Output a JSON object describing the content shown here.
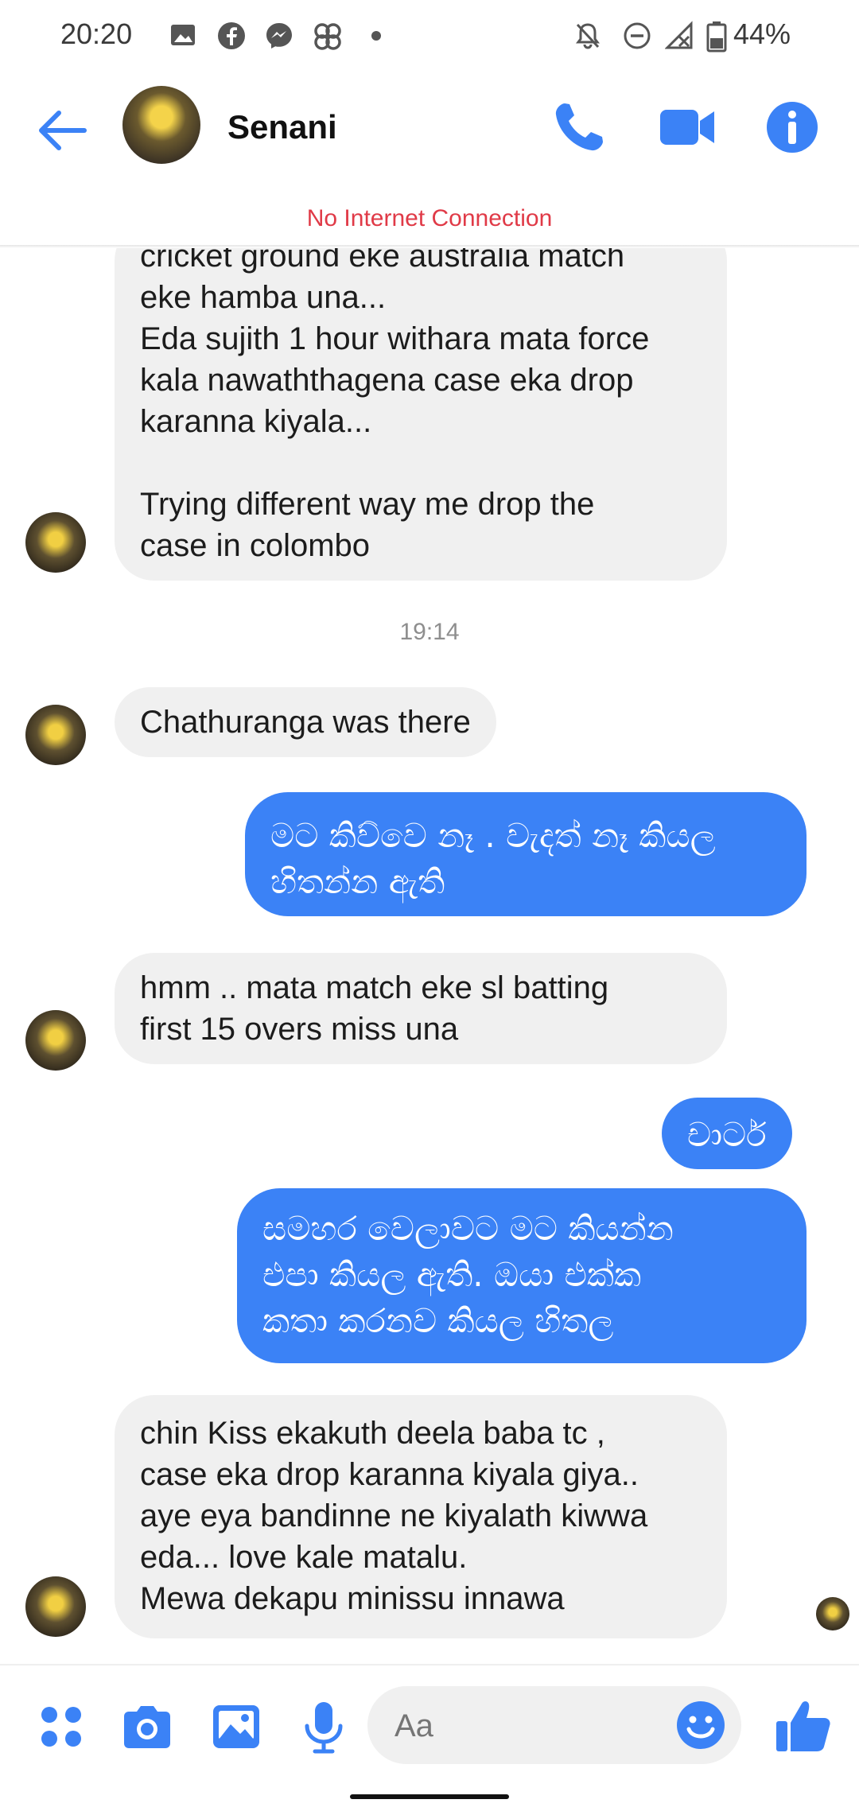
{
  "status_bar": {
    "time": "20:20",
    "battery": "44%"
  },
  "header": {
    "contact_name": "Senani",
    "banner": "No Internet Connection",
    "icons": [
      "back-arrow-icon",
      "phone-icon",
      "video-camera-icon",
      "info-icon"
    ]
  },
  "messages": [
    {
      "dir": "in",
      "text": "cricket ground eke australia match\neke hamba una...\nEda sujith 1 hour withara mata force\nkala nawaththagena case eka drop\nkaranna kiyala...\n\nTrying different  way me drop the\ncase in colombo"
    },
    {
      "dir": "time",
      "text": "19:14"
    },
    {
      "dir": "in",
      "text": "Chathuranga was there"
    },
    {
      "dir": "out",
      "text": "මට කිව්වෙ නෑ . වැදත් නෑ කියල\nහිතන්න ඇති"
    },
    {
      "dir": "in",
      "text": "hmm .. mata match eke sl batting\nfirst 15 overs miss una"
    },
    {
      "dir": "out",
      "text": "චාටර්"
    },
    {
      "dir": "out",
      "text": "සමහර වෙලාවට මට කියන්න\nඑපා කියල ඇති. ඔයා එක්ක\nකතා කරනව කියල හිතල"
    },
    {
      "dir": "in",
      "text": "chin Kiss ekakuth deela baba  tc ,\ncase eka drop karanna kiyala giya..\naye eya bandinne ne kiyalath kiwwa\neda...  love kale matalu.\nMewa dekapu minissu innawa"
    }
  ],
  "composer": {
    "placeholder": "Aa",
    "icons": [
      "apps-icon",
      "camera-icon",
      "gallery-icon",
      "microphone-icon",
      "emoji-icon",
      "thumbs-up-icon"
    ]
  },
  "colors": {
    "accent": "#3b82f6",
    "banner": "#e03a47",
    "incoming_bubble": "#f0f0f0"
  }
}
